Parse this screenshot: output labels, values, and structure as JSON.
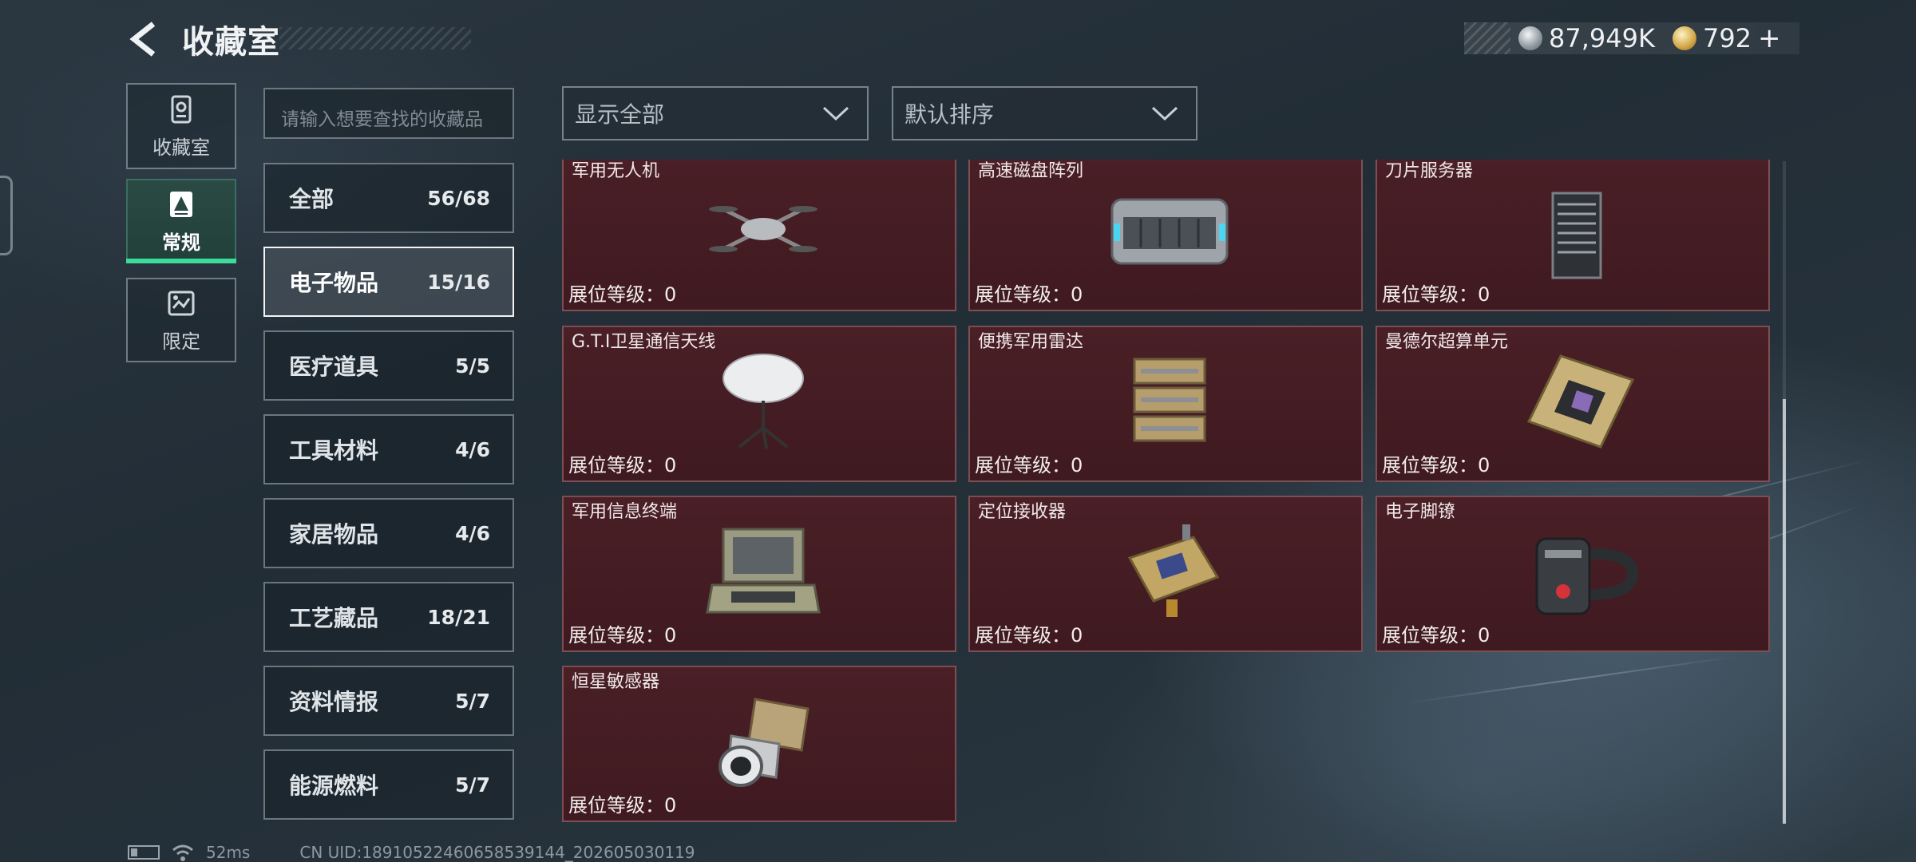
{
  "header": {
    "title": "收藏室",
    "currency": [
      {
        "icon": "silver-coin-icon",
        "value": "87,949K"
      },
      {
        "icon": "gold-coin-icon",
        "value": "792"
      }
    ],
    "plus_label": "+"
  },
  "side_tabs": [
    {
      "label": "收藏室",
      "icon": "collection-room-icon",
      "active": false
    },
    {
      "label": "常规",
      "icon": "regular-icon",
      "active": true
    },
    {
      "label": "限定",
      "icon": "limited-icon",
      "active": false
    }
  ],
  "search": {
    "placeholder": "请输入想要查找的收藏品"
  },
  "categories": [
    {
      "name": "全部",
      "count": "56/68",
      "active": false
    },
    {
      "name": "电子物品",
      "count": "15/16",
      "active": true
    },
    {
      "name": "医疗道具",
      "count": "5/5",
      "active": false
    },
    {
      "name": "工具材料",
      "count": "4/6",
      "active": false
    },
    {
      "name": "家居物品",
      "count": "4/6",
      "active": false
    },
    {
      "name": "工艺藏品",
      "count": "18/21",
      "active": false
    },
    {
      "name": "资料情报",
      "count": "5/7",
      "active": false
    },
    {
      "name": "能源燃料",
      "count": "5/7",
      "active": false
    }
  ],
  "filters": {
    "display": {
      "value": "显示全部"
    },
    "sort": {
      "value": "默认排序"
    }
  },
  "items": [
    {
      "name": "军用无人机",
      "level_text": "展位等级：0",
      "icon": "drone-icon"
    },
    {
      "name": "高速磁盘阵列",
      "level_text": "展位等级：0",
      "icon": "disk-array-icon"
    },
    {
      "name": "刀片服务器",
      "level_text": "展位等级：0",
      "icon": "blade-server-icon"
    },
    {
      "name": "G.T.I卫星通信天线",
      "level_text": "展位等级：0",
      "icon": "satellite-antenna-icon"
    },
    {
      "name": "便携军用雷达",
      "level_text": "展位等级：0",
      "icon": "radar-icon"
    },
    {
      "name": "曼德尔超算单元",
      "level_text": "展位等级：0",
      "icon": "supercomputer-unit-icon"
    },
    {
      "name": "军用信息终端",
      "level_text": "展位等级：0",
      "icon": "military-terminal-icon"
    },
    {
      "name": "定位接收器",
      "level_text": "展位等级：0",
      "icon": "gps-receiver-icon"
    },
    {
      "name": "电子脚镣",
      "level_text": "展位等级：0",
      "icon": "ankle-monitor-icon"
    },
    {
      "name": "恒星敏感器",
      "level_text": "展位等级：0",
      "icon": "star-sensor-icon"
    }
  ],
  "footer": {
    "ping": "52ms",
    "uid": "CN UID:18910522460658539144_202605030119"
  }
}
